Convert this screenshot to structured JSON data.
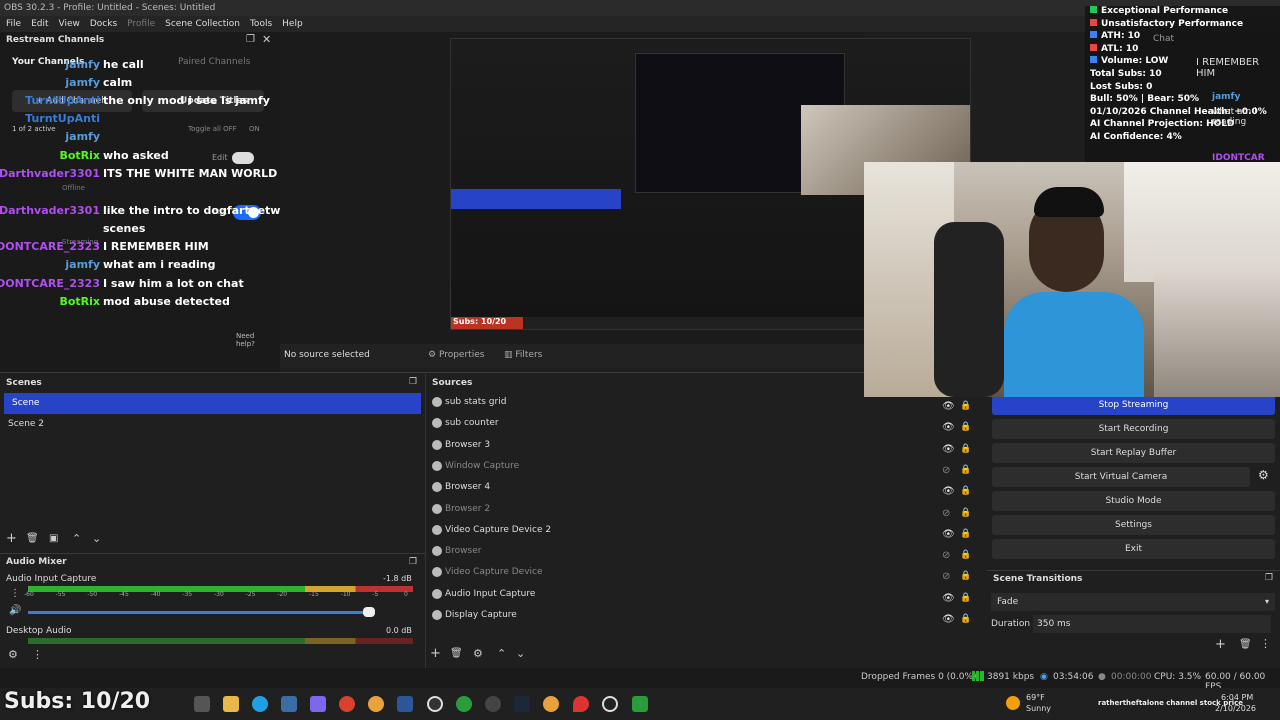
{
  "window_title": "OBS 30.2.3 - Profile: Untitled - Scenes: Untitled",
  "menu": [
    "File",
    "Edit",
    "View",
    "Docks",
    "Profile",
    "Scene Collection",
    "Tools",
    "Help"
  ],
  "restream": {
    "title": "Restream Channels",
    "your_channels": "Your Channels",
    "paired_channels": "Paired Channels",
    "add_channel": "+ Add Channel",
    "update_titles": "Update Titles",
    "active_count": "1 of 2 active",
    "toggle_all": "Toggle all OFF",
    "toggle_on": "ON",
    "edit": "Edit",
    "offline": "Offline",
    "streaming": "Streaming",
    "need_help": "Need help?"
  },
  "chat": [
    {
      "user": "jamfy",
      "msg": "he call",
      "color": "#5b9bd5"
    },
    {
      "user": "jamfy",
      "msg": "calm",
      "color": "#5b9bd5"
    },
    {
      "user": "TurntUpAnti",
      "msg": "the only mod i see is jamfy",
      "color": "#3a7bd5"
    },
    {
      "user": "TurntUpAnti",
      "msg": "",
      "color": "#3a7bd5"
    },
    {
      "user": "jamfy",
      "msg": "",
      "color": "#5b9bd5"
    },
    {
      "user": "BotRix",
      "msg": "who asked",
      "color": "#53fc18"
    },
    {
      "user": "Darthvader3301",
      "msg": "ITS THE WHITE MAN WORLD",
      "color": "#b04ef0"
    },
    {
      "user": "",
      "msg": "",
      "color": "#fff"
    },
    {
      "user": "Darthvader3301",
      "msg": "like the intro to dogfartnetwork bukkake",
      "color": "#b04ef0"
    },
    {
      "user": "",
      "msg": "scenes",
      "color": "#fff"
    },
    {
      "user": "IDONTCARE_2323",
      "msg": "I REMEMBER HIM",
      "color": "#b04ef0"
    },
    {
      "user": "jamfy",
      "msg": "what am i reading",
      "color": "#5b9bd5"
    },
    {
      "user": "IDONTCARE_2323",
      "msg": "I saw him a lot on chat",
      "color": "#b04ef0"
    },
    {
      "user": "BotRix",
      "msg": "mod abuse detected",
      "color": "#53fc18"
    }
  ],
  "properties": {
    "no_source": "No source selected",
    "properties_btn": "Properties",
    "filters_btn": "Filters"
  },
  "scenes": {
    "title": "Scenes",
    "items": [
      "Scene",
      "Scene 2"
    ]
  },
  "sources": {
    "title": "Sources",
    "items": [
      {
        "name": "sub stats grid",
        "visible": true
      },
      {
        "name": "sub counter",
        "visible": true
      },
      {
        "name": "Browser 3",
        "visible": true
      },
      {
        "name": "Window Capture",
        "visible": false
      },
      {
        "name": "Browser 4",
        "visible": true
      },
      {
        "name": "Browser 2",
        "visible": false
      },
      {
        "name": "Video Capture Device 2",
        "visible": true
      },
      {
        "name": "Browser",
        "visible": false
      },
      {
        "name": "Video Capture Device",
        "visible": false
      },
      {
        "name": "Audio Input Capture",
        "visible": true
      },
      {
        "name": "Display Capture",
        "visible": true
      }
    ]
  },
  "mixer": {
    "title": "Audio Mixer",
    "channels": [
      {
        "name": "Audio Input Capture",
        "db": "-1.8 dB"
      },
      {
        "name": "Desktop Audio",
        "db": "0.0 dB"
      }
    ],
    "scale": [
      "-60",
      "-55",
      "-50",
      "-45",
      "-40",
      "-35",
      "-30",
      "-25",
      "-20",
      "-15",
      "-10",
      "-5",
      "0"
    ]
  },
  "controls": {
    "stop_streaming": "Stop Streaming",
    "start_recording": "Start Recording",
    "start_replay": "Start Replay Buffer",
    "start_virtual": "Start Virtual Camera",
    "studio_mode": "Studio Mode",
    "settings": "Settings",
    "exit": "Exit"
  },
  "transitions": {
    "title": "Scene Transitions",
    "fade": "Fade",
    "duration_label": "Duration",
    "duration": "350 ms"
  },
  "stats_overlay": [
    {
      "text": "Exceptional Performance",
      "color": "#22c55e"
    },
    {
      "text": "Unsatisfactory Performance",
      "color": "#ef4444"
    },
    {
      "text": "ATH: 10",
      "color": "#3b82f6"
    },
    {
      "text": "ATL: 10",
      "color": "#ef4444"
    },
    {
      "text": "Volume: LOW",
      "color": "#3b82f6"
    },
    {
      "text": "Total Subs: 10",
      "color": ""
    },
    {
      "text": "Lost Subs: 0",
      "color": ""
    },
    {
      "text": "Bull: 50% | Bear: 50%",
      "color": ""
    },
    {
      "text": "01/10/2026 Channel Health: +0.0%",
      "color": ""
    },
    {
      "text": "AI Channel Projection: HOLD",
      "color": ""
    },
    {
      "text": "AI Confidence: 4%",
      "color": ""
    }
  ],
  "overlay_chat": {
    "label": "Chat",
    "line1": "I REMEMBER HIM",
    "user1": "jamfy",
    "line2": "what am i reading",
    "user2": "IDONTCAR"
  },
  "statusbar": {
    "dropped": "Dropped Frames 0 (0.0%)",
    "kbps": "3891 kbps",
    "stream_time": "03:54:06",
    "rec_time": "00:00:00",
    "cpu": "CPU: 3.5%",
    "fps": "60.00 / 60.00 FPS"
  },
  "subs_overlay": "Subs: 10/20",
  "weather": {
    "temp": "69°F",
    "cond": "Sunny"
  },
  "clock": {
    "time": "6:04 PM",
    "date": "2/10/2026"
  },
  "ticker": "rathertheftalone channel stock price"
}
